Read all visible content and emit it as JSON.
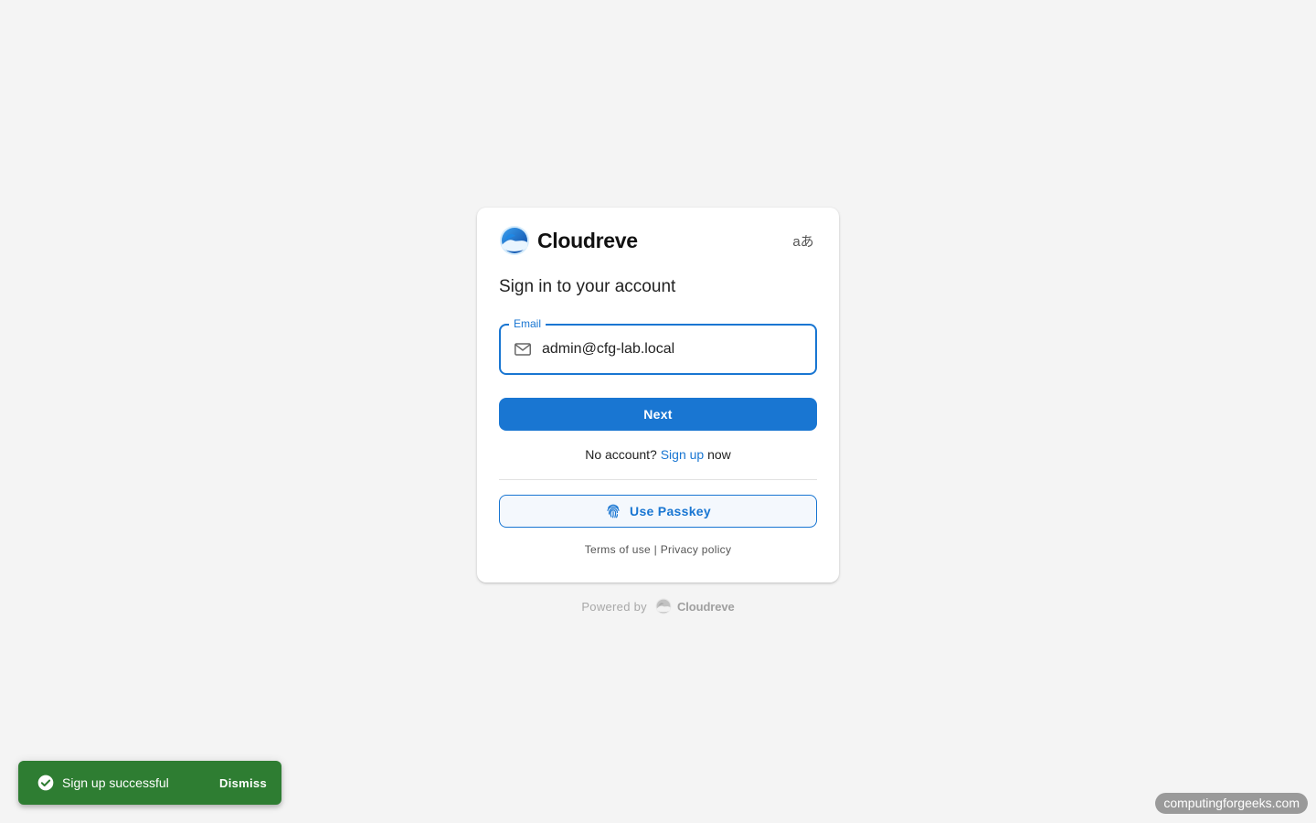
{
  "brand": {
    "name": "Cloudreve",
    "accent_color": "#1976d2"
  },
  "header": {
    "language_icon": "translate-icon",
    "language_glyph": "aあ"
  },
  "login": {
    "title": "Sign in to your account",
    "email_label": "Email",
    "email_value": "admin@cfg-lab.local",
    "email_icon": "mail-icon",
    "next_label": "Next",
    "no_account_prefix": "No account?",
    "signup_link": "Sign up",
    "no_account_suffix": "now",
    "passkey_label": "Use Passkey",
    "passkey_icon": "fingerprint-icon",
    "terms_label": "Terms of use",
    "separator": "|",
    "privacy_label": "Privacy policy"
  },
  "footer": {
    "powered_by": "Powered by",
    "brand_name": "Cloudreve"
  },
  "snackbar": {
    "message": "Sign up successful",
    "dismiss_label": "Dismiss",
    "icon": "check-circle-icon",
    "color": "#2e7d32"
  },
  "watermark": {
    "text": "computingforgeeks.com"
  }
}
